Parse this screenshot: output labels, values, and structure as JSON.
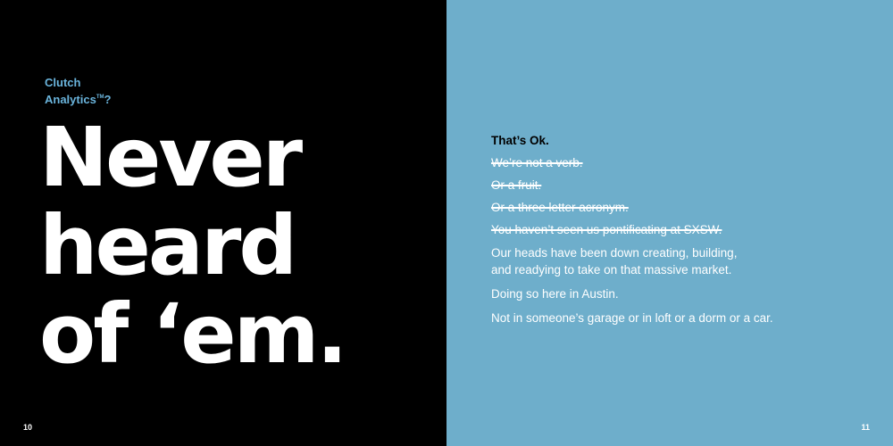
{
  "left_page": {
    "kicker_line1": "Clutch",
    "kicker_line2": "Analytics",
    "kicker_tm": "TM",
    "kicker_q": "?",
    "headline": [
      "Never",
      "heard",
      "of ‘em."
    ],
    "page_number": "10"
  },
  "right_page": {
    "lead": "That’s Ok.",
    "struck_lines": [
      "We’re not a verb.",
      "Or a fruit.",
      "Or a three letter acronym.",
      "You haven’t seen us pontificating at SXSW."
    ],
    "paragraph1_line1": "Our heads have been down creating, building,",
    "paragraph1_line2": "and readying to take on that massive market.",
    "paragraph2": "Doing so here in Austin.",
    "paragraph3": "Not in someone’s garage or in loft or a dorm or a car.",
    "page_number": "11"
  },
  "colors": {
    "left_background": "#000000",
    "right_background": "#6eaecb",
    "kicker": "#6ab4dc"
  }
}
